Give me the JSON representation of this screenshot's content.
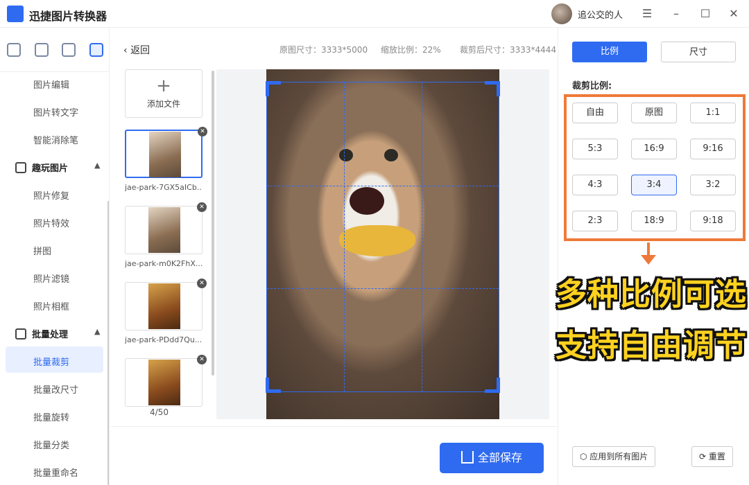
{
  "app": {
    "title": "迅捷图片转换器",
    "username": "追公交的人"
  },
  "window": {
    "menu_icon": "menu-icon",
    "minimize_icon": "minimize-icon",
    "maximize_icon": "maximize-icon",
    "close_icon": "close-icon"
  },
  "sidebar": {
    "tabs": [
      "convert-icon",
      "crop-icon",
      "image-icon",
      "batch-icon"
    ],
    "items": [
      {
        "label": "图片编辑",
        "type": "item"
      },
      {
        "label": "图片转文字",
        "type": "item"
      },
      {
        "label": "智能消除笔",
        "type": "item"
      },
      {
        "label": "趣玩图片",
        "type": "group"
      },
      {
        "label": "照片修复",
        "type": "item"
      },
      {
        "label": "照片特效",
        "type": "item"
      },
      {
        "label": "拼图",
        "type": "item"
      },
      {
        "label": "照片滤镜",
        "type": "item"
      },
      {
        "label": "照片相框",
        "type": "item"
      },
      {
        "label": "批量处理",
        "type": "group"
      },
      {
        "label": "批量裁剪",
        "type": "item",
        "active": true
      },
      {
        "label": "批量改尺寸",
        "type": "item"
      },
      {
        "label": "批量旋转",
        "type": "item"
      },
      {
        "label": "批量分类",
        "type": "item"
      },
      {
        "label": "批量重命名",
        "type": "item"
      }
    ]
  },
  "toolbar": {
    "back_label": "返回",
    "original_size": "原图尺寸：3333*5000",
    "zoom": "缩放比例：22%",
    "cropped_size": "裁剪后尺寸：3333*4444"
  },
  "files": {
    "add_label": "添加文件",
    "items": [
      {
        "name": "jae-park-7GX5aICb...",
        "selected": true
      },
      {
        "name": "jae-park-m0K2FhX..."
      },
      {
        "name": "jae-park-PDdd7Qu..."
      },
      {
        "name": ""
      }
    ],
    "counter": "4/50"
  },
  "actions": {
    "save_all": "全部保存",
    "apply_all": "应用到所有图片",
    "reset": "重置"
  },
  "right_panel": {
    "tabs": [
      "比例",
      "尺寸"
    ],
    "section_label": "裁剪比例:",
    "ratios": [
      "自由",
      "原图",
      "1:1",
      "5:3",
      "16:9",
      "9:16",
      "4:3",
      "3:4",
      "3:2",
      "2:3",
      "18:9",
      "9:18"
    ],
    "active_ratio": "3:4",
    "promo_lines": [
      "多种比例可选",
      "支持自由调节"
    ]
  },
  "colors": {
    "accent": "#2f6bf0",
    "highlight": "#ee7a3a",
    "promo": "#ffd21f"
  }
}
